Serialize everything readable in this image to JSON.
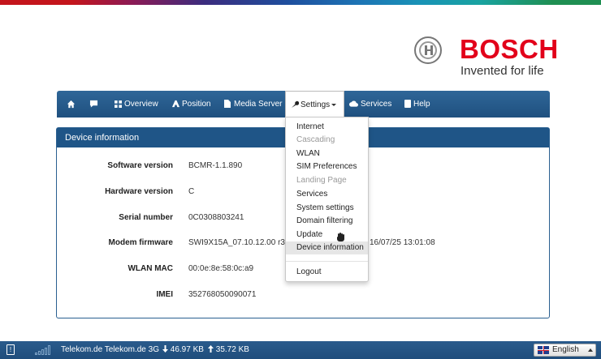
{
  "brand": {
    "name": "BOSCH",
    "tagline": "Invented for life",
    "stripe_colors": [
      "#c4151c",
      "#3b2c7e",
      "#1d75b5",
      "#19a3a0",
      "#1f8f52"
    ]
  },
  "nav": {
    "home_icon": "home-icon",
    "chat_icon": "chat-icon",
    "items": [
      {
        "label": "Overview",
        "icon": "grid-icon"
      },
      {
        "label": "Position",
        "icon": "position-icon"
      },
      {
        "label": "Media Server",
        "icon": "file-icon"
      },
      {
        "label": "Settings",
        "icon": "wrench-icon"
      },
      {
        "label": "Services",
        "icon": "cloud-icon"
      },
      {
        "label": "Help",
        "icon": "book-icon"
      }
    ]
  },
  "settings_menu": {
    "items": [
      {
        "label": "Internet",
        "enabled": true
      },
      {
        "label": "Cascading",
        "enabled": false
      },
      {
        "label": "WLAN",
        "enabled": true
      },
      {
        "label": "SIM Preferences",
        "enabled": true
      },
      {
        "label": "Landing Page",
        "enabled": false
      },
      {
        "label": "Services",
        "enabled": true
      },
      {
        "label": "System settings",
        "enabled": true
      },
      {
        "label": "Domain filtering",
        "enabled": true
      },
      {
        "label": "Update",
        "enabled": true
      },
      {
        "label": "Device information",
        "enabled": true,
        "highlighted": true
      }
    ],
    "logout": "Logout"
  },
  "panel": {
    "title": "Device information",
    "rows": [
      {
        "label": "Software version",
        "value": "BCMR-1.1.890"
      },
      {
        "label": "Hardware version",
        "value": "C"
      },
      {
        "label": "Serial number",
        "value": "0C0308803241"
      },
      {
        "label": "Modem firmware",
        "value": "SWI9X15A_07.10.12.00 r328",
        "value_tail": "16/07/25 13:01:08"
      },
      {
        "label": "WLAN MAC",
        "value": "00:0e:8e:58:0c:a9"
      },
      {
        "label": "IMEI",
        "value": "352768050090071"
      }
    ]
  },
  "footer": {
    "sim_icon": "sim-card-icon",
    "signal_icon": "signal-strength-icon",
    "network": "Telekom.de Telekom.de 3G",
    "download": "46.97 KB",
    "upload": "35.72 KB",
    "language": "English"
  }
}
